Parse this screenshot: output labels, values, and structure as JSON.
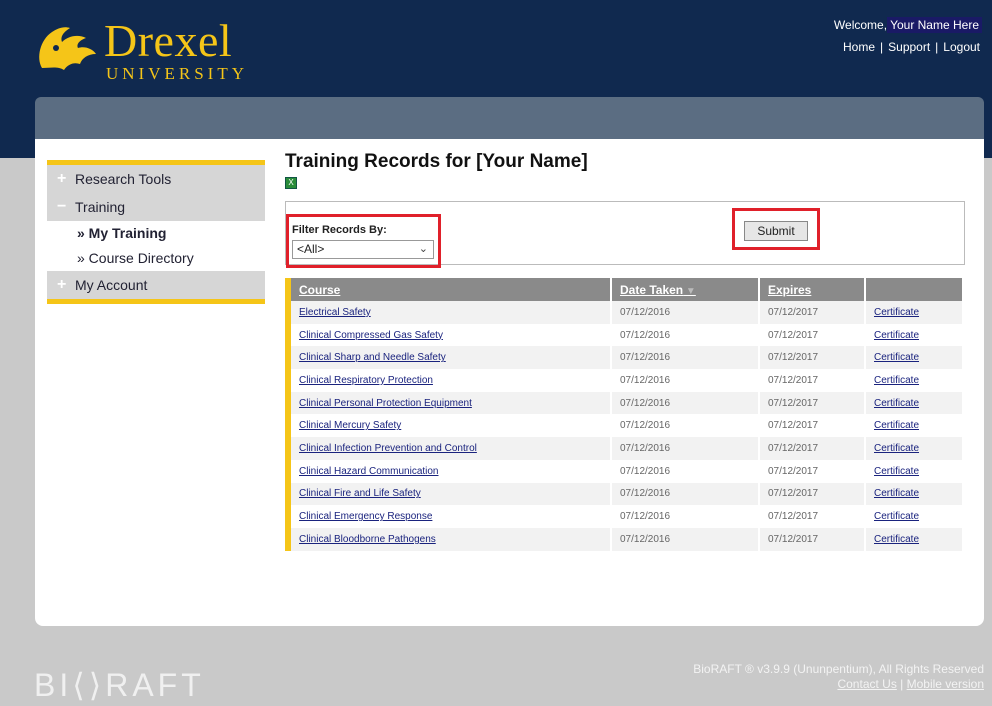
{
  "header": {
    "logo_word": "Drexel",
    "logo_sub": "UNIVERSITY",
    "welcome_prefix": "Welcome,",
    "user_name": "Your Name Here",
    "links": [
      "Home",
      "Support",
      "Logout"
    ]
  },
  "sidebar": {
    "items": [
      {
        "icon": "+",
        "label": "Research Tools"
      },
      {
        "icon": "−",
        "label": "Training"
      },
      {
        "label": "» My Training"
      },
      {
        "label": "» Course Directory"
      },
      {
        "icon": "+",
        "label": "My Account"
      }
    ]
  },
  "page": {
    "title_prefix": "Training Records for",
    "title_name": "[Your Name]",
    "excel_icon": "excel-export-icon"
  },
  "filter": {
    "label": "Filter Records By:",
    "selected": "<All>",
    "submit_label": "Submit"
  },
  "table": {
    "headers": [
      "Course",
      "Date Taken",
      "Expires",
      ""
    ],
    "rows": [
      {
        "course": "Electrical Safety",
        "date": "07/12/2016",
        "expires": "07/12/2017",
        "action": "Certificate"
      },
      {
        "course": "Clinical Compressed Gas Safety",
        "date": "07/12/2016",
        "expires": "07/12/2017",
        "action": "Certificate"
      },
      {
        "course": "Clinical Sharp and Needle Safety",
        "date": "07/12/2016",
        "expires": "07/12/2017",
        "action": "Certificate"
      },
      {
        "course": "Clinical Respiratory Protection",
        "date": "07/12/2016",
        "expires": "07/12/2017",
        "action": "Certificate"
      },
      {
        "course": "Clinical Personal Protection Equipment",
        "date": "07/12/2016",
        "expires": "07/12/2017",
        "action": "Certificate"
      },
      {
        "course": "Clinical Mercury Safety",
        "date": "07/12/2016",
        "expires": "07/12/2017",
        "action": "Certificate"
      },
      {
        "course": "Clinical Infection Prevention and Control",
        "date": "07/12/2016",
        "expires": "07/12/2017",
        "action": "Certificate"
      },
      {
        "course": "Clinical Hazard Communication",
        "date": "07/12/2016",
        "expires": "07/12/2017",
        "action": "Certificate"
      },
      {
        "course": "Clinical Fire and Life Safety",
        "date": "07/12/2016",
        "expires": "07/12/2017",
        "action": "Certificate"
      },
      {
        "course": "Clinical Emergency Response",
        "date": "07/12/2016",
        "expires": "07/12/2017",
        "action": "Certificate"
      },
      {
        "course": "Clinical Bloodborne Pathogens",
        "date": "07/12/2016",
        "expires": "07/12/2017",
        "action": "Certificate"
      }
    ]
  },
  "footer": {
    "brand": "BI⟨⟩RAFT",
    "copyright": "BioRAFT ® v3.9.9 (Ununpentium), All Rights Reserved",
    "contact": "Contact Us",
    "mobile": "Mobile version"
  },
  "colors": {
    "navy": "#10294f",
    "gold": "#f5c518",
    "highlight": "#e0202a"
  }
}
